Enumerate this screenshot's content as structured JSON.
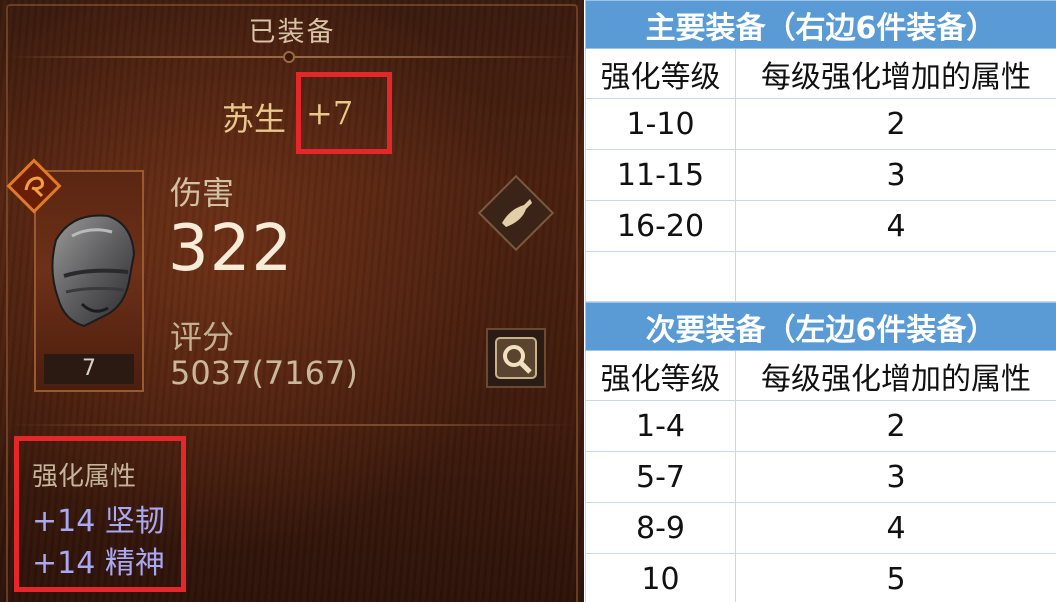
{
  "game_panel": {
    "title": "已装备",
    "item_name": "苏生",
    "upgrade_level": "+7",
    "item_count": "7",
    "damage_label": "伤害",
    "damage_value": "322",
    "score_label": "评分",
    "score_value": "5037(7167)",
    "enhance_title": "强化属性",
    "enhance_attrs": [
      "+14 坚韧",
      "+14 精神"
    ],
    "highlight_color": "#e5262a",
    "attr_color": "#a9a8f2"
  },
  "main_table": {
    "title": "主要装备（右边6件装备）",
    "headers": [
      "强化等级",
      "每级强化增加的属性"
    ],
    "rows": [
      [
        "1-10",
        "2"
      ],
      [
        "11-15",
        "3"
      ],
      [
        "16-20",
        "4"
      ]
    ]
  },
  "sub_table": {
    "title": "次要装备（左边6件装备）",
    "headers": [
      "强化等级",
      "每级强化增加的属性"
    ],
    "rows": [
      [
        "1-4",
        "2"
      ],
      [
        "5-7",
        "3"
      ],
      [
        "8-9",
        "4"
      ],
      [
        "10",
        "5"
      ]
    ]
  },
  "table_header_color": "#5b9bd5"
}
